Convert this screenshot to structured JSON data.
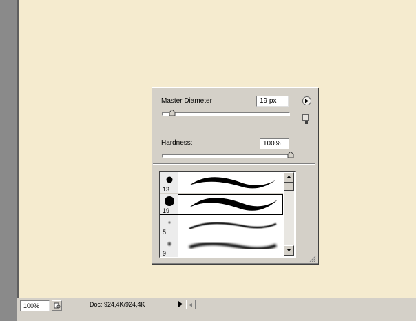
{
  "brush_panel": {
    "master_diameter": {
      "label": "Master Diameter",
      "value": "19 px",
      "slider_level": 0.08
    },
    "hardness": {
      "label": "Hardness:",
      "value": "100%",
      "slider_level": 1.0
    },
    "menu_button_icon": "play-arrow-icon",
    "resize_icon": "new-preset-icon",
    "presets": [
      {
        "size": "13",
        "softness": "hard",
        "selected": false
      },
      {
        "size": "19",
        "softness": "hard",
        "selected": true
      },
      {
        "size": "5",
        "softness": "soft",
        "selected": false
      },
      {
        "size": "9",
        "softness": "soft",
        "selected": false
      }
    ]
  },
  "status_bar": {
    "zoom": "100%",
    "doc_info": "Doc: 924,4K/924,4K"
  },
  "colors": {
    "canvas": "#f5ebcf",
    "panel": "#d4d0c8",
    "workspace": "#8a8a8a"
  }
}
